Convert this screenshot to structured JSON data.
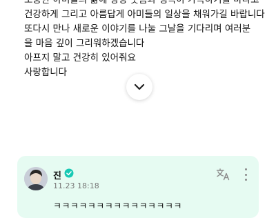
{
  "post": {
    "lines": [
      "소중한 아미들의 삶에 항상 웃음과 행복이 가득하기를 바라고",
      "건강하게 그리고 아름답게 아미들의 일상을 채워가길 바랍니다",
      "또다시 만나 새로운 이야기를 나눌 그날을 기다리며 여러분",
      "을 마음 깊이 그리워하겠습니다",
      "아프지 말고 건강히 있어줘요",
      "사랑합니다"
    ]
  },
  "icons": {
    "expand": "chevron-down-icon",
    "verified": "verified-check-icon",
    "translate": "translate-icon",
    "more": "more-vertical-icon"
  },
  "comment": {
    "author": "진",
    "timestamp": "11.23 18:18",
    "text": "ㅋㅋㅋㅋㅋㅋㅋㅋㅋㅋㅋㅋㅋㅋㅋ"
  },
  "colors": {
    "verified": "#16c9b4",
    "comment_bg": "#e6fbf2"
  }
}
